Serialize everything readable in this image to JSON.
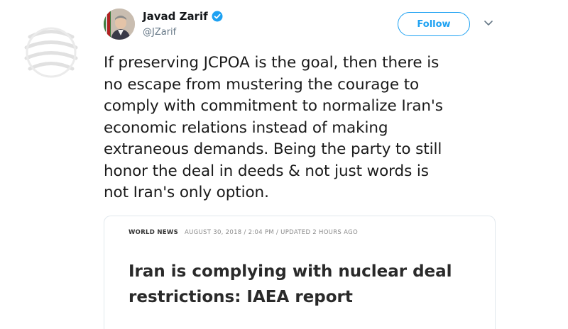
{
  "tweet": {
    "author_name": "Javad Zarif",
    "handle": "@JZarif",
    "verified": true,
    "follow_label": "Follow",
    "text_lines": [
      "If preserving JCPOA is the goal, then there is",
      "no escape from mustering the courage to",
      "comply with commitment to normalize Iran's",
      "economic relations instead of making",
      "extraneous demands. Being the party to still",
      "honor the deal in deeds & not just words is",
      "not Iran's only option."
    ]
  },
  "card": {
    "section": "WORLD NEWS",
    "timestamp": "AUGUST 30, 2018 / 2:04 PM / UPDATED 2 HOURS AGO",
    "headline_lines": [
      "Iran is complying with nuclear deal",
      "restrictions: IAEA report"
    ]
  },
  "colors": {
    "accent": "#1da1f2",
    "text": "#14171a",
    "muted": "#657786",
    "border": "#e1e8ed"
  },
  "icons": {
    "verified": "verified-badge-icon",
    "menu": "chevron-down-icon",
    "watermark": "watermark-logo"
  }
}
